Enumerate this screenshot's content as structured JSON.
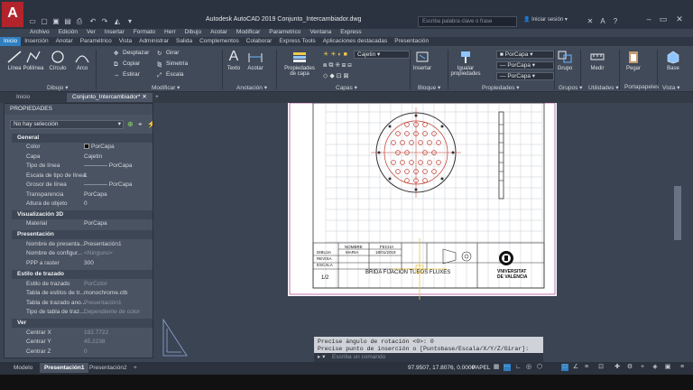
{
  "app": {
    "logo_letter": "A",
    "title": "Autodesk AutoCAD 2019    Conjunto_Intercambiador.dwg",
    "search_placeholder": "Escriba palabra clave o frase",
    "signin": "Iniciar sesión"
  },
  "menubar": [
    "Archivo",
    "Edición",
    "Ver",
    "Insertar",
    "Formato",
    "Herr",
    "Dibujo",
    "Acotar",
    "Modificar",
    "Parametrico",
    "Ventana",
    "Express"
  ],
  "ribbon_tabs": [
    "Inicio",
    "Inserción",
    "Anotar",
    "Paramétrico",
    "Vista",
    "Administrar",
    "Salida",
    "Complementos",
    "Colaborar",
    "Express Tools",
    "Aplicaciones destacadas",
    "Presentación"
  ],
  "active_ribbon_tab": "Inicio",
  "ribbon": {
    "draw": {
      "linea": "Línea",
      "polilinea": "Polilínea",
      "circulo": "Círculo",
      "arco": "Arco"
    },
    "modify": {
      "desplazar": "Desplazar",
      "girar": "Girar",
      "copiar": "Copiar",
      "simetria": "Simetría",
      "estirar": "Estirar",
      "escala": "Escala"
    },
    "annotation": {
      "texto": "Texto",
      "acotar": "Acotar"
    },
    "layers": {
      "propiedades": "Propiedades de capa",
      "current": "Cajetin"
    },
    "block": {
      "insertar": "Insertar"
    },
    "properties": {
      "igualar": "Igualar propiedades",
      "color": "PorCapa",
      "linetype": "PorCapa",
      "lineweight": "PorCapa"
    },
    "groups": {
      "grupo": "Grupo"
    },
    "utilities": {
      "medir": "Medir"
    },
    "clipboard": {
      "pegar": "Pegar"
    },
    "view": {
      "base": "Base"
    },
    "panel_labels": [
      "Dibujo ▾",
      "Modificar ▾",
      "Anotación ▾",
      "Capas ▾",
      "Bloque ▾",
      "Propiedades ▾",
      "Grupos ▾",
      "Utilidades ▾",
      "Portapapeles",
      "Vista ▾"
    ]
  },
  "file_tabs": [
    "Inicio",
    "Conjunto_Intercambiador*"
  ],
  "properties": {
    "header": "PROPIEDADES",
    "selection": "No hay selección",
    "sections": {
      "general": "General",
      "vis3d": "Visualización 3D",
      "presentacion": "Presentación",
      "trazado": "Estilo de trazado",
      "ver": "Ver"
    },
    "general": [
      {
        "k": "Color",
        "v": "PorCapa"
      },
      {
        "k": "Capa",
        "v": "Cajetin"
      },
      {
        "k": "Tipo de línea",
        "v": "———— PorCapa"
      },
      {
        "k": "Escala de tipo de línea",
        "v": "1"
      },
      {
        "k": "Grosor de línea",
        "v": "———— PorCapa"
      },
      {
        "k": "Transparencia",
        "v": "PorCapa"
      },
      {
        "k": "Altura de objeto",
        "v": "0"
      }
    ],
    "vis3d": [
      {
        "k": "Material",
        "v": "PorCapa"
      }
    ],
    "presentacion": [
      {
        "k": "Nombre de presenta...",
        "v": "Presentación1"
      },
      {
        "k": "Nombre de configur...",
        "v": "<Ninguno>"
      },
      {
        "k": "PPP a raster",
        "v": "300"
      }
    ],
    "trazado": [
      {
        "k": "Estilo de trazado",
        "v": "PorColor"
      },
      {
        "k": "Tabla de estilos de tr...",
        "v": "monochrome.ctb"
      },
      {
        "k": "Tabla de trazado ano...",
        "v": "Presentación1"
      },
      {
        "k": "Tipo de tabla de traz...",
        "v": "Dependiente de color"
      }
    ],
    "ver": [
      {
        "k": "Centrar X",
        "v": "192.7722"
      },
      {
        "k": "Centrar Y",
        "v": "45.2238"
      },
      {
        "k": "Centrar Z",
        "v": "0"
      }
    ]
  },
  "title_block": {
    "nombre": "NOMBRE",
    "fecha": "FECHA",
    "dibuja": "DIBUJA",
    "revisa": "REVISA",
    "escala": "ESCALA",
    "author": "MARIA",
    "date": "18/01/2019",
    "scale": "1/2",
    "part_title": "BRIDA FIJACIÓN TUBOS FLUXES",
    "university": "VNIVERSITAT\nDE VALÈNCIA"
  },
  "command": {
    "line1": "Precise ángulo de rotación <0>: 0",
    "line2": "Precise punto de inserción o [Puntobase/Escala/X/Y/Z/Girar]:",
    "placeholder": "Escriba un comando"
  },
  "status": {
    "layout_tabs": [
      "Modelo",
      "Presentación1",
      "Presentación2"
    ],
    "active_layout": "Presentación1",
    "coords": "97.9507, 17.8076, 0.0000",
    "space": "PAPEL"
  }
}
